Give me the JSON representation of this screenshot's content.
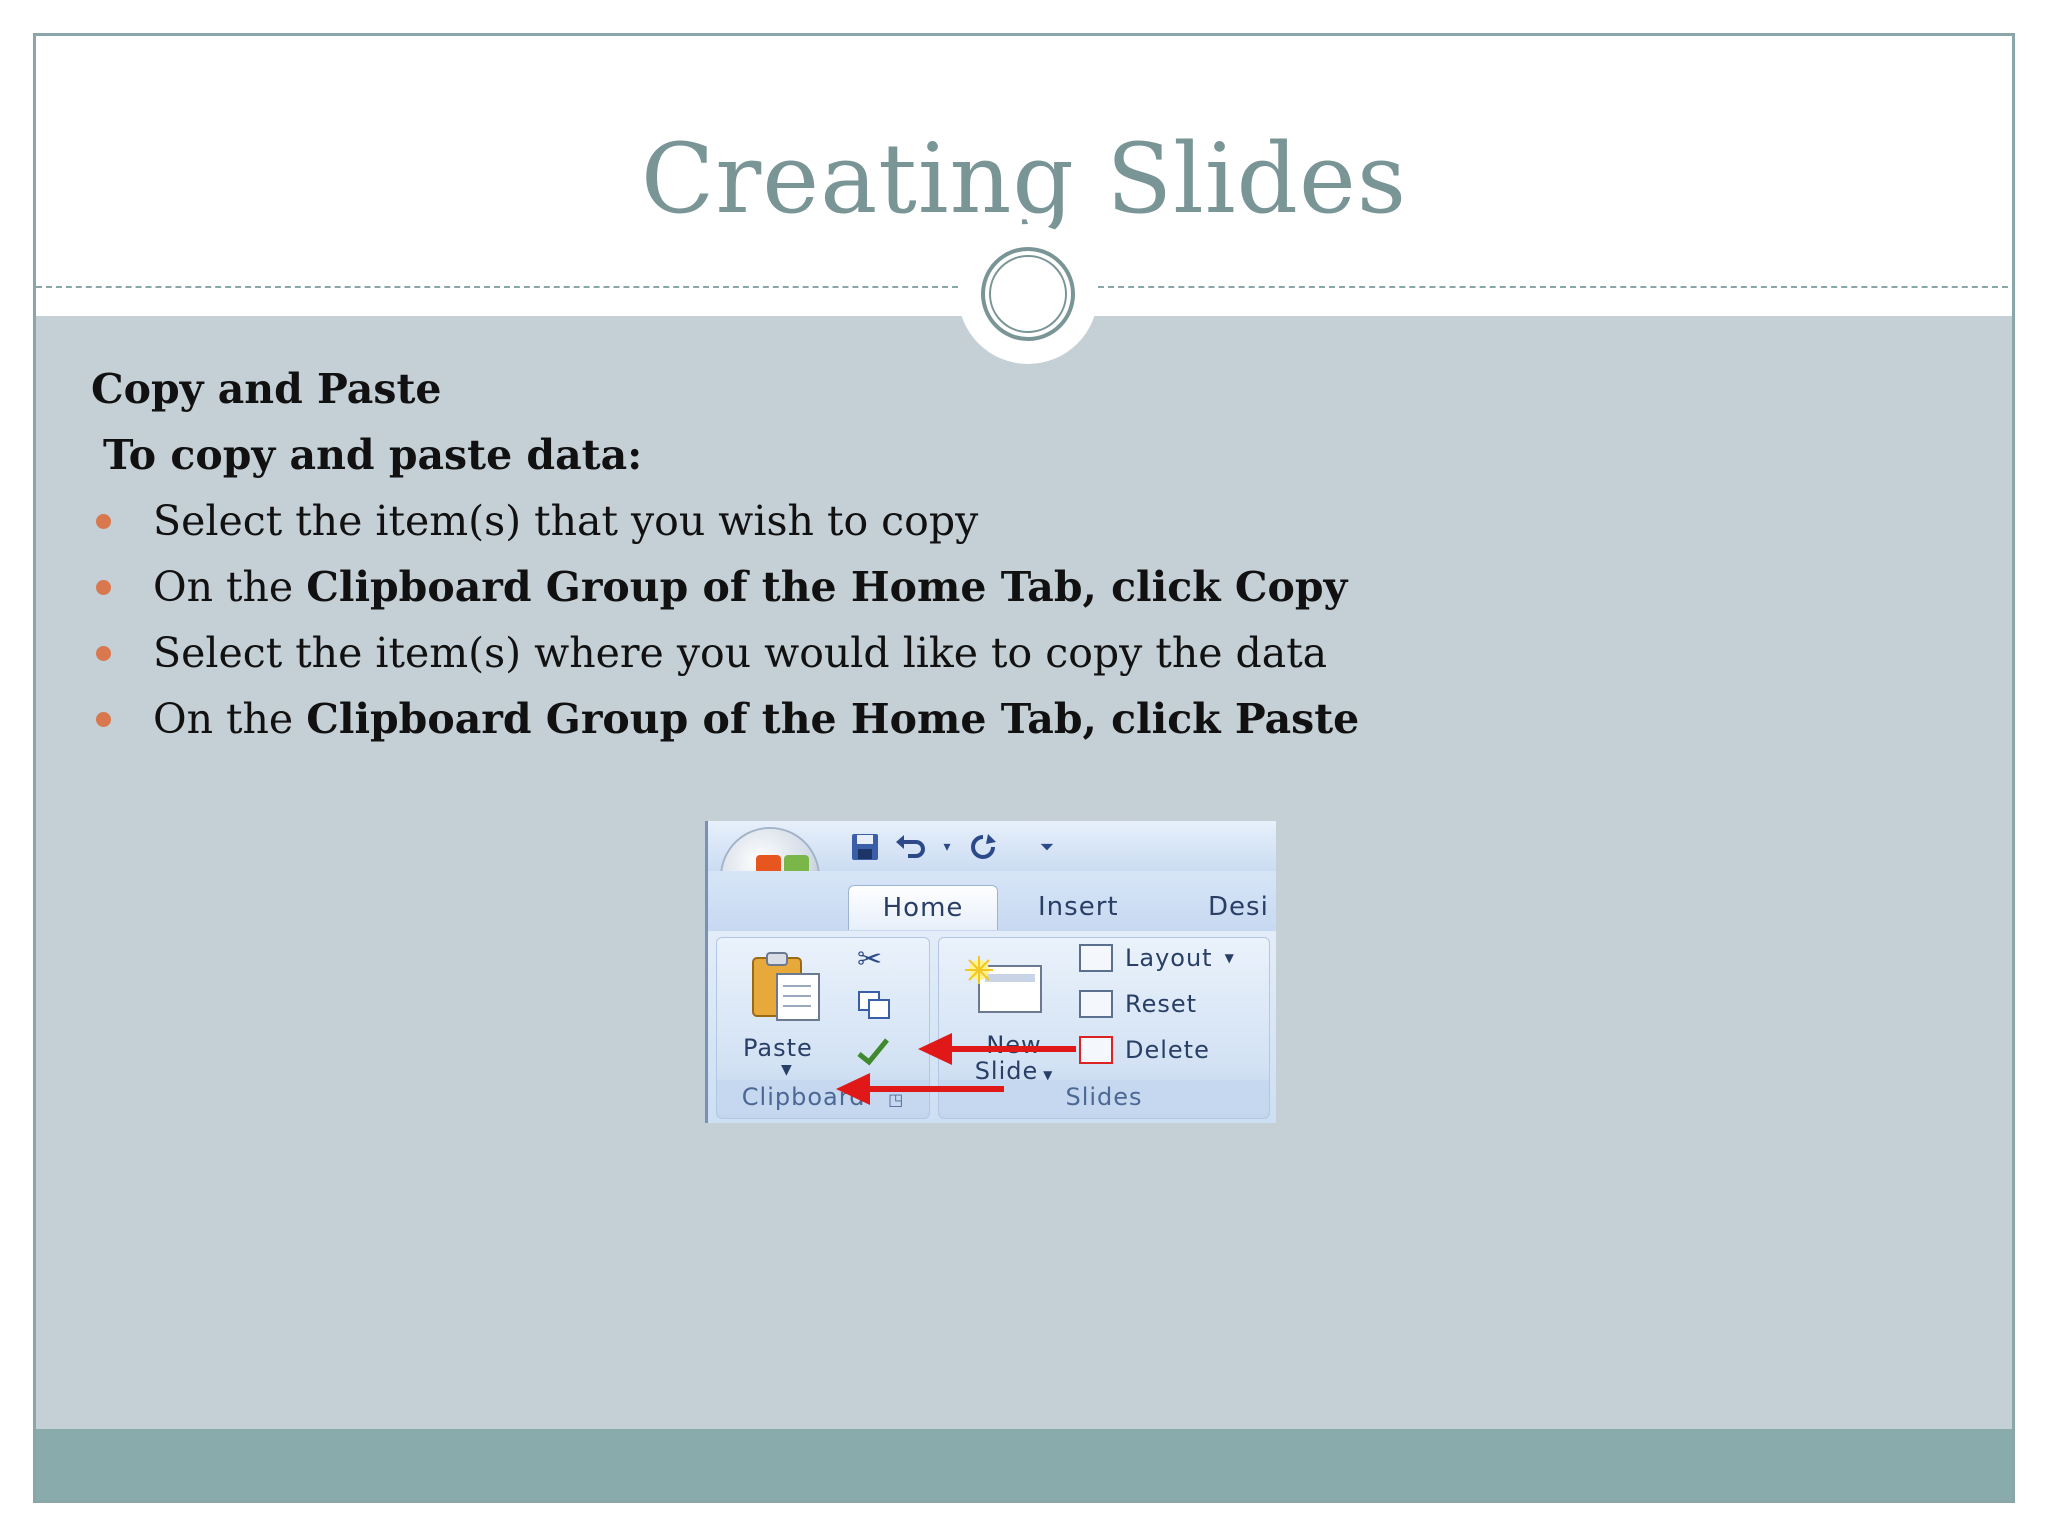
{
  "slide": {
    "title": "Creating Slides",
    "heading1": "Copy and Paste",
    "heading2": "To copy and paste data:",
    "bullets": [
      {
        "plain": "Select the item(s) that you wish to copy",
        "prefix": "",
        "bold": ""
      },
      {
        "plain": "",
        "prefix": "On the ",
        "bold": "Clipboard Group of the Home Tab, click Copy"
      },
      {
        "plain": "Select the item(s) where you would like to copy the data",
        "prefix": "",
        "bold": ""
      },
      {
        "plain": "",
        "prefix": "On the ",
        "bold": "Clipboard Group of the Home Tab, click Paste"
      }
    ]
  },
  "ribbon": {
    "tabs": [
      "Home",
      "Insert",
      "Desi"
    ],
    "paste_label": "Paste",
    "clipboard_label": "Clipboard",
    "new_slide_label_1": "New",
    "new_slide_label_2": "Slide",
    "layout_label": "Layout",
    "reset_label": "Reset",
    "delete_label": "Delete",
    "slides_group_label": "Slides",
    "icons": {
      "office": "office-button-icon",
      "save": "save-icon",
      "undo": "undo-icon",
      "redo": "redo-icon",
      "customize": "customize-qat-icon",
      "cut": "scissors-icon",
      "copy": "copy-icon",
      "format_painter": "format-painter-icon",
      "paste": "clipboard-paste-icon"
    }
  },
  "colors": {
    "title": "#7a9596",
    "content_bg": "#c4cfd6",
    "footer": "#8aabab",
    "bullet": "#d9774e",
    "arrow": "#e01818"
  }
}
